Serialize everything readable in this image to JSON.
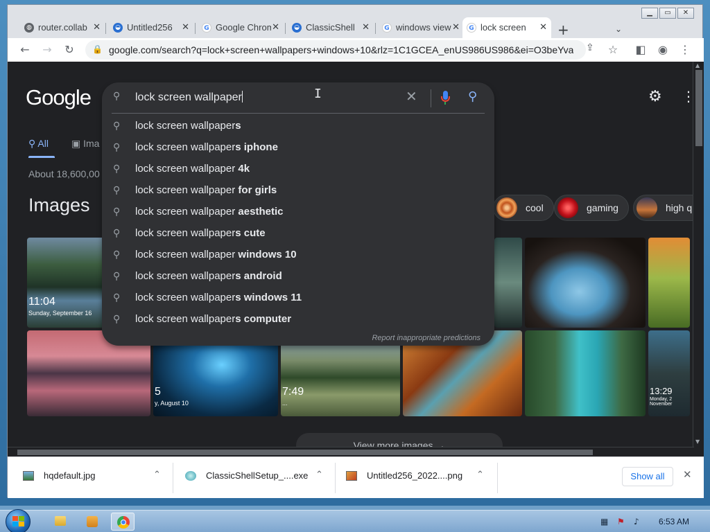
{
  "browser": {
    "tabs": [
      {
        "title": "router.collab",
        "favicon": "globe-icon",
        "active": false
      },
      {
        "title": "Untitled256",
        "favicon": "classicshell-icon",
        "active": false
      },
      {
        "title": "Google Chrome",
        "favicon": "google-icon",
        "active": false
      },
      {
        "title": "ClassicShell",
        "favicon": "classicshell-icon",
        "active": false
      },
      {
        "title": "windows view",
        "favicon": "google-icon",
        "active": false
      },
      {
        "title": "lock screen",
        "favicon": "google-icon",
        "active": true
      }
    ],
    "tab_close_glyph": "✕",
    "new_tab_glyph": "+",
    "url": "google.com/search?q=lock+screen+wallpapers+windows+10&rlz=1C1GCEA_enUS986US986&ei=O3beYva..."
  },
  "google": {
    "logo": "Google",
    "search_query": "lock screen wallpaper",
    "suggestions": [
      {
        "prefix": "lock screen wallpaper",
        "bold": "s"
      },
      {
        "prefix": "lock screen wallpaper",
        "bold": "s iphone"
      },
      {
        "prefix": "lock screen wallpaper",
        "bold": " 4k"
      },
      {
        "prefix": "lock screen wallpaper",
        "bold": " for girls"
      },
      {
        "prefix": "lock screen wallpaper",
        "bold": " aesthetic"
      },
      {
        "prefix": "lock screen wallpaper",
        "bold": "s cute"
      },
      {
        "prefix": "lock screen wallpaper",
        "bold": " windows 10"
      },
      {
        "prefix": "lock screen wallpaper",
        "bold": "s android"
      },
      {
        "prefix": "lock screen wallpaper",
        "bold": "s windows 11"
      },
      {
        "prefix": "lock screen wallpaper",
        "bold": "s computer"
      }
    ],
    "report_text": "Report inappropriate predictions",
    "nav_all": "All",
    "nav_images": "Ima",
    "result_stats": "About 18,600,00",
    "images_heading": "Images",
    "chips": [
      {
        "label": "cool"
      },
      {
        "label": "gaming"
      },
      {
        "label": "high q"
      }
    ],
    "thumb_captions": {
      "t1_time": "11:04",
      "t1_date": "Sunday, September 16",
      "t2_time": "5",
      "t2_date": "y, August 10",
      "t3_time": "7:49",
      "t3_date": "...",
      "t4_time": "13:29",
      "t4_date": "Monday, 2 November"
    },
    "view_more": "View more images →"
  },
  "downloads": {
    "items": [
      {
        "name": "hqdefault.jpg"
      },
      {
        "name": "ClassicShellSetup_....exe"
      },
      {
        "name": "Untitled256_2022....png"
      }
    ],
    "chevron_glyph": "⌃",
    "show_all": "Show all",
    "close_glyph": "✕"
  },
  "taskbar": {
    "clock": "6:53 AM"
  },
  "colors": {
    "page_bg": "#202124",
    "searchbox_bg": "#303134",
    "accent_blue": "#8ab4f8",
    "link_blue": "#1a73e8"
  }
}
